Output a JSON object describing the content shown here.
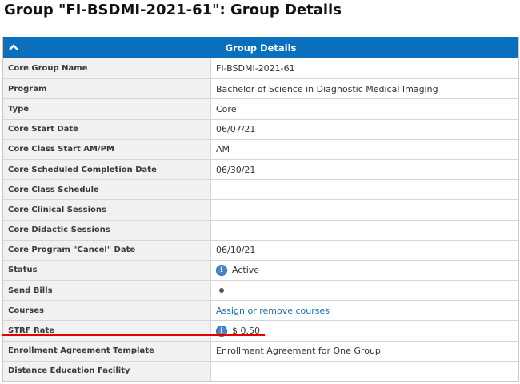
{
  "page": {
    "title": "Group \"FI-BSDMI-2021-61\": Group Details"
  },
  "panel": {
    "header": "Group Details",
    "rows": [
      {
        "label": "Core Group Name",
        "value": "FI-BSDMI-2021-61"
      },
      {
        "label": "Program",
        "value": "Bachelor of Science in Diagnostic Medical Imaging"
      },
      {
        "label": "Type",
        "value": "Core"
      },
      {
        "label": "Core Start Date",
        "value": "06/07/21"
      },
      {
        "label": "Core Class Start AM/PM",
        "value": "AM"
      },
      {
        "label": "Core Scheduled Completion Date",
        "value": "06/30/21"
      },
      {
        "label": "Core Class Schedule",
        "value": ""
      },
      {
        "label": "Core Clinical Sessions",
        "value": ""
      },
      {
        "label": "Core Didactic Sessions",
        "value": ""
      },
      {
        "label": "Core Program \"Cancel\" Date",
        "value": "06/10/21"
      },
      {
        "label": "Status",
        "value": "Active",
        "icon": "info-icon"
      },
      {
        "label": "Send Bills",
        "value": "",
        "icon": "bullet-icon"
      },
      {
        "label": "Courses",
        "value": "Assign or remove courses",
        "link": true
      },
      {
        "label": "STRF Rate",
        "value": "$ 0.50",
        "icon": "info-icon"
      },
      {
        "label": "Enrollment Agreement Template",
        "value": "Enrollment Agreement for One Group"
      },
      {
        "label": "Distance Education Facility",
        "value": ""
      }
    ]
  },
  "colors": {
    "header_bg": "#0a70bd",
    "label_bg": "#f1f1f1",
    "link": "#1a6fb5",
    "annotation_underline": "#e60000"
  }
}
